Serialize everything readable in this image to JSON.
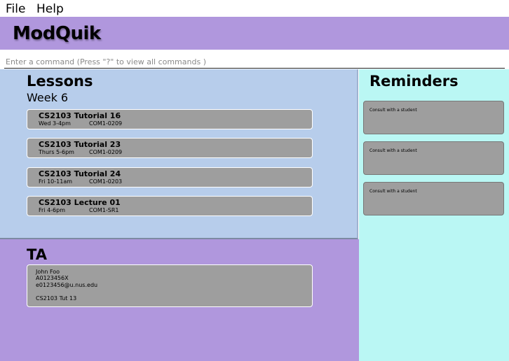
{
  "menu": {
    "file": "File",
    "help": "Help"
  },
  "app": {
    "title": "ModQuik"
  },
  "command": {
    "placeholder": "Enter a command (Press \"?\" to view all commands )"
  },
  "lessons": {
    "title": "Lessons",
    "week": "Week 6",
    "items": [
      {
        "name": "CS2103 Tutorial 16",
        "time": "Wed 3-4pm",
        "venue": "COM1-0209"
      },
      {
        "name": "CS2103 Tutorial 23",
        "time": "Thurs 5-6pm",
        "venue": "COM1-0209"
      },
      {
        "name": "CS2103 Tutorial 24",
        "time": "Fri 10-11am",
        "venue": "COM1-0203"
      },
      {
        "name": "CS2103 Lecture 01",
        "time": "Fri 4-6pm",
        "venue": "COM1-SR1"
      }
    ]
  },
  "ta": {
    "title": "TA",
    "name": "John Foo",
    "id": "A0123456X",
    "email": "e0123456@u.nus.edu",
    "tutorial": "CS2103 Tut 13"
  },
  "reminders": {
    "title": "Reminders",
    "items": [
      {
        "text": "Consult with a student"
      },
      {
        "text": "Consult with a student"
      },
      {
        "text": "Consult with a student"
      }
    ]
  },
  "colors": {
    "header": "#b097dd",
    "lessons_panel": "#b7cdeb",
    "reminders_panel": "#baf7f4",
    "card": "#9e9e9e"
  }
}
